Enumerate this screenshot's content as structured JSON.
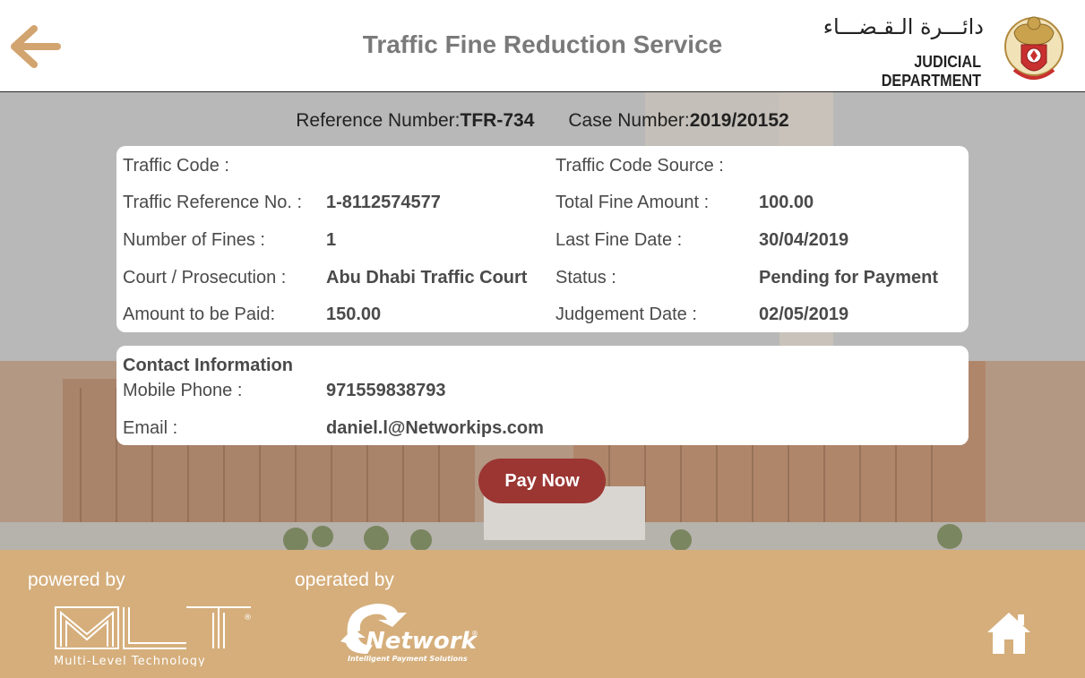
{
  "header": {
    "title": "Traffic Fine Reduction Service",
    "dept_name_arabic": "دائـــرة الـقـضـــاء",
    "dept_name_english": "JUDICIAL DEPARTMENT",
    "back_icon": "arrow-left-icon",
    "emblem": "abu-dhabi-emblem"
  },
  "reference": {
    "reference_label": "Reference Number:",
    "reference_value": "TFR-734",
    "case_label": "Case Number:",
    "case_value": "2019/20152"
  },
  "fine_details": {
    "traffic_code_label": "Traffic Code :",
    "traffic_code_value": "",
    "traffic_code_source_label": "Traffic Code Source :",
    "traffic_code_source_value": "",
    "traffic_ref_label": "Traffic Reference No. :",
    "traffic_ref_value": "1-8112574577",
    "total_fine_label": "Total Fine Amount :",
    "total_fine_value": "100.00",
    "num_fines_label": "Number of Fines :",
    "num_fines_value": "1",
    "last_fine_date_label": "Last Fine Date :",
    "last_fine_date_value": "30/04/2019",
    "court_label": "Court / Prosecution :",
    "court_value": "Abu Dhabi Traffic Court",
    "status_label": "Status :",
    "status_value": "Pending for Payment",
    "amount_label": "Amount to be Paid:",
    "amount_value": "150.00",
    "judgement_date_label": "Judgement Date :",
    "judgement_date_value": "02/05/2019"
  },
  "contact": {
    "title": "Contact Information",
    "mobile_label": "Mobile Phone :",
    "mobile_value": "971559838793",
    "email_label": "Email :",
    "email_value": "daniel.l@Networkips.com"
  },
  "actions": {
    "pay_label": "Pay Now"
  },
  "footer": {
    "powered_by_label": "powered by",
    "operated_by_label": "operated by",
    "mlt_logo_text": "MLT",
    "mlt_tagline": "Multi-Level Technology",
    "network_logo_text": "Network",
    "network_tagline": "Intelligent Payment Solutions",
    "home_icon": "home-icon"
  },
  "colors": {
    "accent_arrow": "#d2a46f",
    "pay_button": "#9b3633",
    "footer_bg": "#d5ae7b",
    "title_text": "#7a7a7a"
  }
}
